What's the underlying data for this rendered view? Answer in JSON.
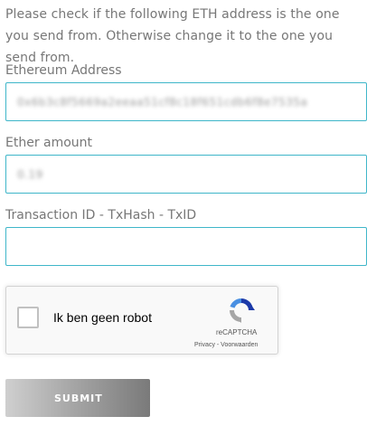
{
  "intro_text": "Please check if the following ETH address is the one you send from. Otherwise change it to the one you send from.",
  "fields": {
    "eth_address": {
      "label": "Ethereum Address",
      "value": "0x6b3c8f5669a2eeaa51cf8c18f651cdb6f8e7535a"
    },
    "ether_amount": {
      "label": "Ether amount",
      "value": "0.19"
    },
    "tx_id": {
      "label": "Transaction ID - TxHash - TxID",
      "value": "",
      "placeholder": ""
    }
  },
  "captcha": {
    "checkbox_label": "Ik ben geen robot",
    "brand": "reCAPTCHA",
    "links": "Privacy - Voorwaarden",
    "checked": false
  },
  "submit_label": "SUBMIT",
  "colors": {
    "field_border": "#3fb6c9",
    "text_gray": "#777777",
    "recaptcha_blue": "#1c3aa9",
    "recaptcha_lightblue": "#4a90e2",
    "recaptcha_gray": "#a6a6a6"
  },
  "icons": {
    "captcha_logo": "recaptcha-logo-icon"
  }
}
